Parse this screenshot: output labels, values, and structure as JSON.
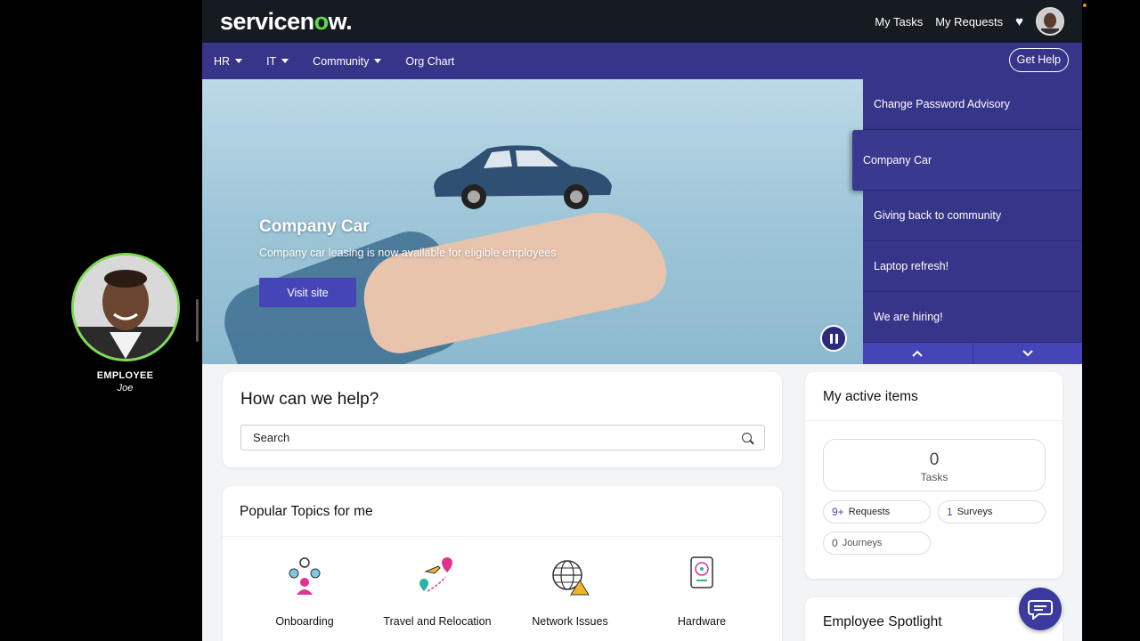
{
  "presenter": {
    "role": "EMPLOYEE",
    "name": "Joe"
  },
  "header": {
    "logo_prefix": "servicen",
    "logo_o": "o",
    "logo_suffix": "w.",
    "links": [
      "My Tasks",
      "My Requests"
    ],
    "heart_icon": "heart-icon",
    "brand_green": "#62d84e"
  },
  "nav": {
    "items": [
      {
        "label": "HR",
        "dropdown": true
      },
      {
        "label": "IT",
        "dropdown": true
      },
      {
        "label": "Community",
        "dropdown": true
      },
      {
        "label": "Org Chart",
        "dropdown": false
      }
    ],
    "get_help": "Get Help"
  },
  "hero": {
    "title": "Company Car",
    "subtitle": "Company car leasing is now available for eligible employees",
    "cta": "Visit site"
  },
  "carousel": {
    "items": [
      "Change Password Advisory",
      "Company Car",
      "Giving back to community",
      "Laptop refresh!",
      "We are hiring!"
    ],
    "active_index": 1
  },
  "help": {
    "title": "How can we help?",
    "search_value": "Search"
  },
  "topics": {
    "title": "Popular Topics for me",
    "items": [
      "Onboarding",
      "Travel and Relocation",
      "Network Issues",
      "Hardware"
    ]
  },
  "active_items": {
    "title": "My active items",
    "tasks_count": "0",
    "tasks_label": "Tasks",
    "pills": [
      {
        "count": "9+",
        "label": "Requests"
      },
      {
        "count": "1",
        "label": "Surveys"
      },
      {
        "count": "0",
        "label": "Journeys"
      }
    ]
  },
  "spotlight": {
    "title": "Employee Spotlight"
  },
  "colors": {
    "nav": "#36358a",
    "topbar": "#161b22",
    "accent": "#4545b8"
  }
}
